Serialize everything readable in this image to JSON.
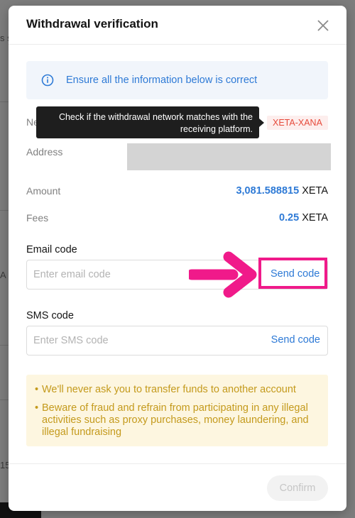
{
  "background": {
    "fragments": [
      "s s",
      "A",
      "15"
    ]
  },
  "modal": {
    "title": "Withdrawal verification",
    "close_icon": "close-icon"
  },
  "info": {
    "icon": "info-icon",
    "text": "Ensure all the information below is correct"
  },
  "network": {
    "label_fragment": "Ne",
    "tooltip_line1": "Check if the withdrawal network matches with the",
    "tooltip_line2": "receiving platform.",
    "value": "XETA-XANA",
    "badge_color": "#e64a3b"
  },
  "address": {
    "label": "Address"
  },
  "amount": {
    "label": "Amount",
    "value": "3,081.588815",
    "unit": "XETA"
  },
  "fees": {
    "label": "Fees",
    "value": "0.25",
    "unit": "XETA"
  },
  "email_code": {
    "label": "Email code",
    "placeholder": "Enter email code",
    "value": "",
    "send_label": "Send code"
  },
  "sms_code": {
    "label": "SMS code",
    "placeholder": "Enter SMS code",
    "value": "",
    "send_label": "Send code"
  },
  "warnings": {
    "bullet": "•",
    "items": [
      "We'll never ask you to transfer funds to another account",
      "Beware of fraud and refrain from participating in any illegal activities such as proxy purchases, money laundering, and illegal fundraising"
    ],
    "color": "#c49a1c"
  },
  "confirm": {
    "label": "Confirm"
  },
  "colors": {
    "accent": "#2e7ad6",
    "highlight": "#f01a8a"
  }
}
